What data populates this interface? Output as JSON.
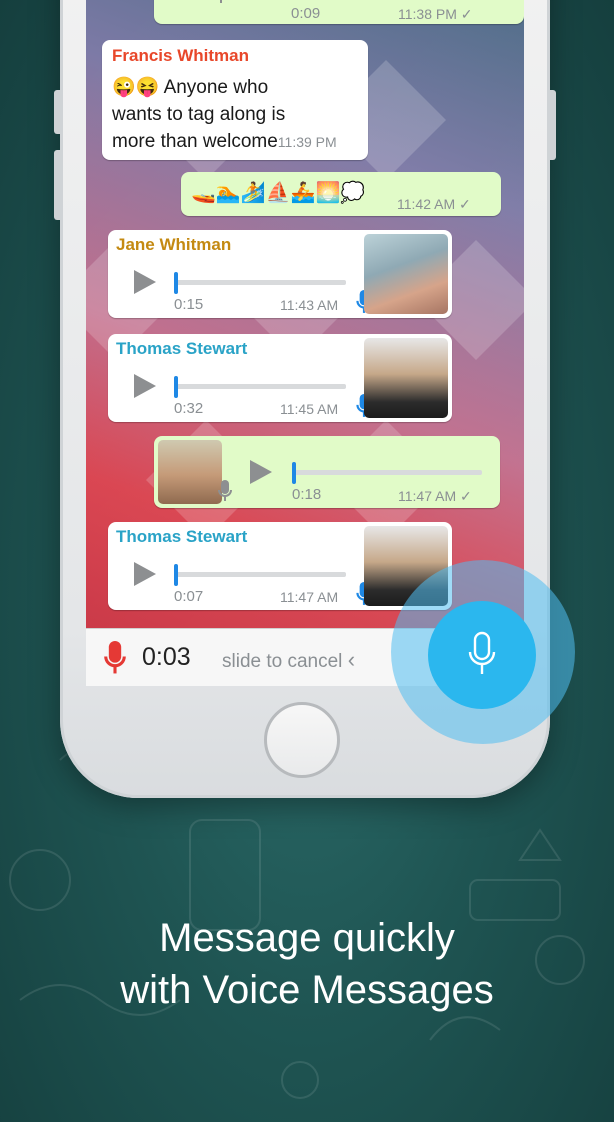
{
  "caption": {
    "line1": "Message quickly",
    "line2": "with Voice Messages"
  },
  "chat": {
    "top_partial": {
      "duration": "0:09",
      "time": "11:38 PM",
      "status": "✓"
    },
    "msg_francis": {
      "sender": "Francis Whitman",
      "sender_color": "#e8472a",
      "emoji": "😜😝",
      "line1": "Anyone who",
      "line2": "wants to tag along is",
      "line3": "more than welcome",
      "time": "11:39 PM"
    },
    "msg_emoji": {
      "emoji": "🚤🏊🏄⛵🚣🌅💭",
      "time": "11:42 AM",
      "status": "✓"
    },
    "voice_jane": {
      "sender": "Jane Whitman",
      "sender_color": "#c48a12",
      "duration": "0:15",
      "time": "11:43 AM",
      "progress": 0.0
    },
    "voice_thomas_1": {
      "sender": "Thomas Stewart",
      "sender_color": "#2aa3c7",
      "duration": "0:32",
      "time": "11:45 AM",
      "progress": 0.0
    },
    "voice_out": {
      "duration": "0:18",
      "time": "11:47 AM",
      "status": "✓",
      "progress": 0.0
    },
    "voice_thomas_2": {
      "sender": "Thomas Stewart",
      "sender_color": "#2aa3c7",
      "duration": "0:07",
      "time": "11:47 AM",
      "progress": 0.0
    }
  },
  "recorder": {
    "elapsed": "0:03",
    "slide_hint": "slide to cancel",
    "chevron": "‹",
    "rec_color": "#e53935",
    "mic_color": "#2bb7ee"
  }
}
